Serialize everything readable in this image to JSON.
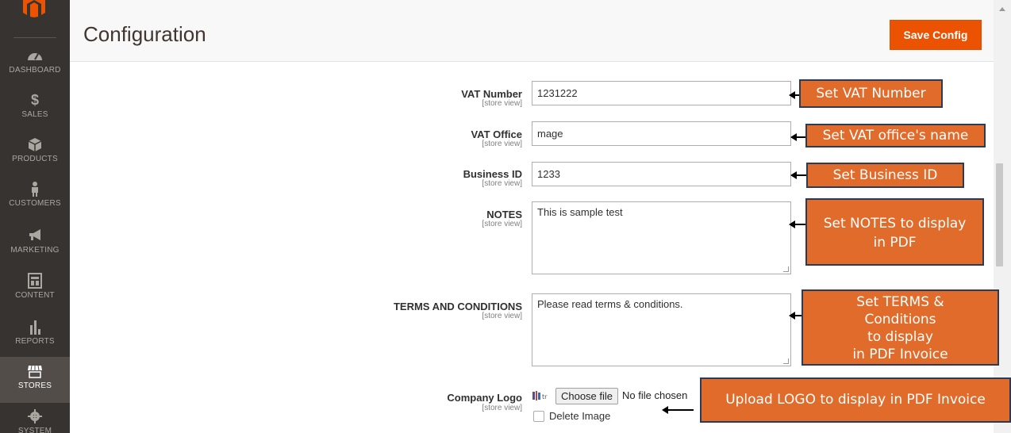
{
  "sidebar": {
    "items": [
      {
        "label": "DASHBOARD",
        "icon": "dashboard-icon"
      },
      {
        "label": "SALES",
        "icon": "dollar-icon"
      },
      {
        "label": "PRODUCTS",
        "icon": "box-icon"
      },
      {
        "label": "CUSTOMERS",
        "icon": "person-icon"
      },
      {
        "label": "MARKETING",
        "icon": "megaphone-icon"
      },
      {
        "label": "CONTENT",
        "icon": "layout-icon"
      },
      {
        "label": "REPORTS",
        "icon": "bar-chart-icon"
      },
      {
        "label": "STORES",
        "icon": "storefront-icon",
        "active": true
      },
      {
        "label": "SYSTEM",
        "icon": "gear-icon"
      }
    ]
  },
  "header": {
    "title": "Configuration",
    "save_label": "Save Config"
  },
  "form": {
    "vat_number": {
      "label": "VAT Number",
      "scope": "[store view]",
      "value": "1231222"
    },
    "vat_office": {
      "label": "VAT Office",
      "scope": "[store view]",
      "value": "mage"
    },
    "business_id": {
      "label": "Business ID",
      "scope": "[store view]",
      "value": "1233"
    },
    "notes": {
      "label": "NOTES",
      "scope": "[store view]",
      "value": "This is sample test"
    },
    "terms": {
      "label": "TERMS AND CONDITIONS",
      "scope": "[store view]",
      "value": "Please read terms & conditions."
    },
    "logo": {
      "label": "Company Logo",
      "scope": "[store view]",
      "choose_label": "Choose file",
      "no_file": "No file chosen",
      "delete_label": "Delete Image"
    }
  },
  "callouts": {
    "vat_number": "Set VAT Number",
    "vat_office": "Set VAT office's name",
    "business_id": "Set Business ID",
    "notes_line1": "Set NOTES to display",
    "notes_line2": "in PDF",
    "terms_line1": "Set TERMS &",
    "terms_line2": "Conditions",
    "terms_line3": "to display",
    "terms_line4": "in PDF Invoice",
    "logo": "Upload LOGO to display in PDF Invoice"
  },
  "colors": {
    "accent": "#eb5202",
    "callout": "#e06b2a",
    "sidebar": "#373330"
  }
}
